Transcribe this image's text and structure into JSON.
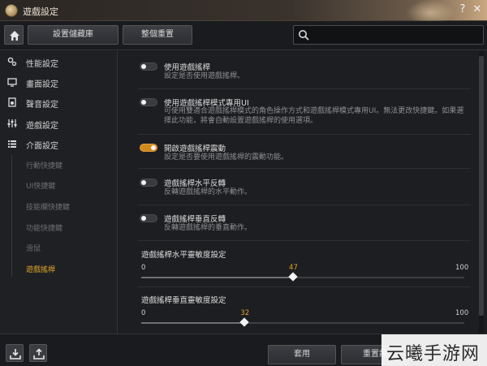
{
  "window": {
    "title": "遊戲設定",
    "help_label": "?",
    "close_label": "✕"
  },
  "toolbar": {
    "save_label": "設置儲藏庫",
    "reset_label": "整個重置",
    "search_placeholder": ""
  },
  "sidebar": {
    "items": [
      {
        "label": "性能設定",
        "icon": "gears-icon"
      },
      {
        "label": "畫面設定",
        "icon": "monitor-icon"
      },
      {
        "label": "聲音設定",
        "icon": "speaker-icon"
      },
      {
        "label": "遊戲設定",
        "icon": "sliders-icon"
      },
      {
        "label": "介面設定",
        "icon": "list-icon"
      }
    ],
    "sub_items": [
      {
        "label": "行動快捷鍵",
        "active": false
      },
      {
        "label": "UI快捷鍵",
        "active": false
      },
      {
        "label": "技能欄快捷鍵",
        "active": false
      },
      {
        "label": "功能快捷鍵",
        "active": false
      },
      {
        "label": "滑鼠",
        "active": false
      },
      {
        "label": "遊戲搖桿",
        "active": true
      }
    ]
  },
  "options": [
    {
      "title": "使用遊戲搖桿",
      "desc": "設定是否使用遊戲搖桿。",
      "on": false
    },
    {
      "title": "使用遊戲搖桿模式專用UI",
      "desc": "可使用雙適合遊戲搖桿模式的角色操作方式和遊戲搖桿模式專用UI。無法更改快捷鍵。如果選擇此功能，將會自動設置遊戲搖桿的使用選項。",
      "on": false
    },
    {
      "title": "開啟遊戲搖桿震動",
      "desc": "設定是否要使用遊戲搖桿的震動功能。",
      "on": true
    },
    {
      "title": "遊戲搖桿水平反轉",
      "desc": "反轉遊戲搖桿的水平動作。",
      "on": false
    },
    {
      "title": "遊戲搖桿垂直反轉",
      "desc": "反轉遊戲搖桿的垂直動作。",
      "on": false
    }
  ],
  "sliders": [
    {
      "title": "遊戲搖桿水平靈敏度設定",
      "min": "0",
      "max": "100",
      "value": "47",
      "fraction": 0.47
    },
    {
      "title": "遊戲搖桿垂直靈敏度設定",
      "min": "0",
      "max": "100",
      "value": "32",
      "fraction": 0.32
    }
  ],
  "bottom": {
    "apply_label": "套用",
    "reset_label": "重置設"
  },
  "watermark": {
    "text": "云曦手游网"
  },
  "colors": {
    "accent": "#e0a52a",
    "toggle_on": "#d08a1c",
    "background": "#1d1e21"
  }
}
